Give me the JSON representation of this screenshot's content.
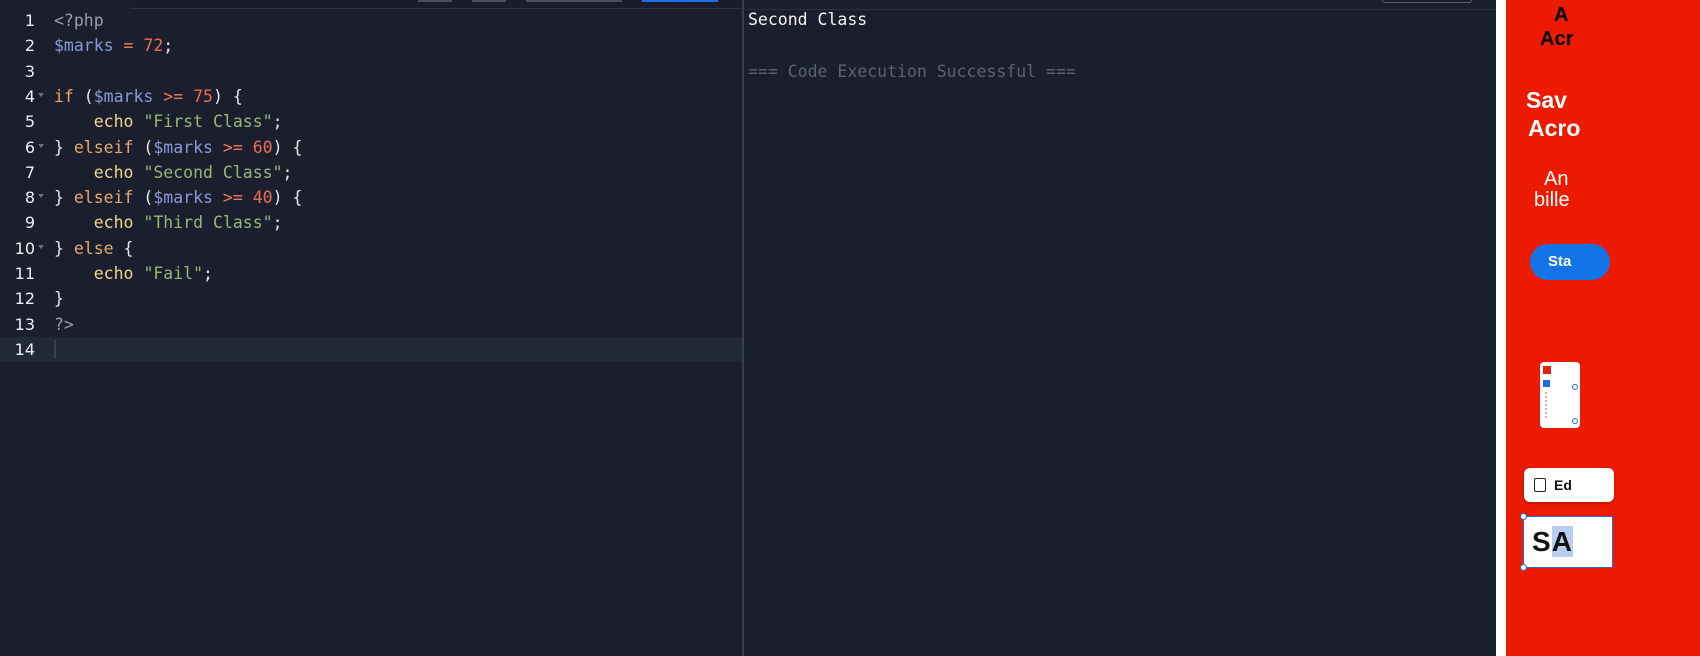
{
  "editor": {
    "lines": [
      {
        "n": "1",
        "fold": false,
        "tokens": [
          {
            "t": "<?php",
            "c": "tag"
          }
        ]
      },
      {
        "n": "2",
        "fold": false,
        "tokens": [
          {
            "t": "$marks",
            "c": "var"
          },
          {
            "t": " ",
            "c": "txt"
          },
          {
            "t": "=",
            "c": "op"
          },
          {
            "t": " ",
            "c": "txt"
          },
          {
            "t": "72",
            "c": "num"
          },
          {
            "t": ";",
            "c": "txt"
          }
        ]
      },
      {
        "n": "3",
        "fold": false,
        "tokens": []
      },
      {
        "n": "4",
        "fold": true,
        "tokens": [
          {
            "t": "if",
            "c": "kw"
          },
          {
            "t": " (",
            "c": "txt"
          },
          {
            "t": "$marks",
            "c": "var"
          },
          {
            "t": " ",
            "c": "txt"
          },
          {
            "t": ">=",
            "c": "op"
          },
          {
            "t": " ",
            "c": "txt"
          },
          {
            "t": "75",
            "c": "num"
          },
          {
            "t": ") {",
            "c": "txt"
          }
        ]
      },
      {
        "n": "5",
        "fold": false,
        "tokens": [
          {
            "t": "    ",
            "c": "txt"
          },
          {
            "t": "echo",
            "c": "fn"
          },
          {
            "t": " ",
            "c": "txt"
          },
          {
            "t": "\"First Class\"",
            "c": "str"
          },
          {
            "t": ";",
            "c": "txt"
          }
        ]
      },
      {
        "n": "6",
        "fold": true,
        "tokens": [
          {
            "t": "} ",
            "c": "txt"
          },
          {
            "t": "elseif",
            "c": "kw"
          },
          {
            "t": " (",
            "c": "txt"
          },
          {
            "t": "$marks",
            "c": "var"
          },
          {
            "t": " ",
            "c": "txt"
          },
          {
            "t": ">=",
            "c": "op"
          },
          {
            "t": " ",
            "c": "txt"
          },
          {
            "t": "60",
            "c": "num"
          },
          {
            "t": ") {",
            "c": "txt"
          }
        ]
      },
      {
        "n": "7",
        "fold": false,
        "tokens": [
          {
            "t": "    ",
            "c": "txt"
          },
          {
            "t": "echo",
            "c": "fn"
          },
          {
            "t": " ",
            "c": "txt"
          },
          {
            "t": "\"Second Class\"",
            "c": "str"
          },
          {
            "t": ";",
            "c": "txt"
          }
        ]
      },
      {
        "n": "8",
        "fold": true,
        "tokens": [
          {
            "t": "} ",
            "c": "txt"
          },
          {
            "t": "elseif",
            "c": "kw"
          },
          {
            "t": " (",
            "c": "txt"
          },
          {
            "t": "$marks",
            "c": "var"
          },
          {
            "t": " ",
            "c": "txt"
          },
          {
            "t": ">=",
            "c": "op"
          },
          {
            "t": " ",
            "c": "txt"
          },
          {
            "t": "40",
            "c": "num"
          },
          {
            "t": ") {",
            "c": "txt"
          }
        ]
      },
      {
        "n": "9",
        "fold": false,
        "tokens": [
          {
            "t": "    ",
            "c": "txt"
          },
          {
            "t": "echo",
            "c": "fn"
          },
          {
            "t": " ",
            "c": "txt"
          },
          {
            "t": "\"Third Class\"",
            "c": "str"
          },
          {
            "t": ";",
            "c": "txt"
          }
        ]
      },
      {
        "n": "10",
        "fold": true,
        "tokens": [
          {
            "t": "} ",
            "c": "txt"
          },
          {
            "t": "else",
            "c": "kw"
          },
          {
            "t": " {",
            "c": "txt"
          }
        ]
      },
      {
        "n": "11",
        "fold": false,
        "tokens": [
          {
            "t": "    ",
            "c": "txt"
          },
          {
            "t": "echo",
            "c": "fn"
          },
          {
            "t": " ",
            "c": "txt"
          },
          {
            "t": "\"Fail\"",
            "c": "str"
          },
          {
            "t": ";",
            "c": "txt"
          }
        ]
      },
      {
        "n": "12",
        "fold": false,
        "tokens": [
          {
            "t": "}",
            "c": "txt"
          }
        ]
      },
      {
        "n": "13",
        "fold": false,
        "tokens": [
          {
            "t": "?>",
            "c": "tag"
          }
        ]
      },
      {
        "n": "14",
        "fold": false,
        "tokens": [],
        "active": true
      }
    ]
  },
  "output": {
    "result": "Second Class",
    "status": "=== Code Execution Successful ==="
  },
  "ad": {
    "brand_line1": "A",
    "brand_line2": "Acr",
    "headline_line1": "Sav",
    "headline_line2": "Acro",
    "body_line1": "An",
    "body_line2": "bille",
    "cta": "Sta",
    "edit_label": "Ed",
    "sample_text_plain": "S",
    "sample_text_highlight": "A",
    "colors": {
      "background": "#ec1b00",
      "cta": "#1473e6"
    }
  },
  "colors": {
    "editor_bg": "#1b1f2d",
    "keyword": "#e6a96a",
    "variable": "#8a9ad8",
    "number": "#ef6b53",
    "string": "#97b678",
    "function": "#f0d48a"
  }
}
